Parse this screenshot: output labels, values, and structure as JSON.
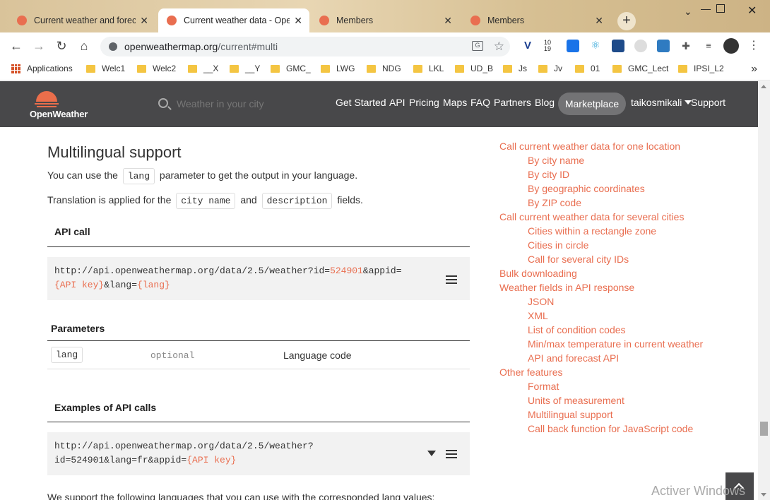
{
  "browser": {
    "tabs": [
      {
        "title": "Current weather and forecast",
        "active": false
      },
      {
        "title": "Current weather data - OpenWeatherMap",
        "active": true
      },
      {
        "title": "Members",
        "active": false
      },
      {
        "title": "Members",
        "active": false
      }
    ],
    "url_host": "openweathermap.org",
    "url_path": "/current#multi",
    "ext_date": "10",
    "ext_date2": "19",
    "bookmarks": [
      "Applications",
      "Welc1",
      "Welc2",
      "__X",
      "__Y",
      "GMC_",
      "LWG",
      "NDG",
      "LKL",
      "UD_B",
      "Js",
      "Jv",
      "01",
      "GMC_Lect",
      "IPSI_L2"
    ]
  },
  "site": {
    "logo_text": "OpenWeather",
    "search_placeholder": "Weather in your city",
    "nav": [
      "Get Started",
      "API",
      "Pricing",
      "Maps",
      "FAQ",
      "Partners",
      "Blog"
    ],
    "marketplace": "Marketplace",
    "user": "taikosmikali",
    "support": "Support"
  },
  "content": {
    "title": "Multilingual support",
    "p1_before": "You can use the",
    "p1_code": "lang",
    "p1_after": "parameter to get the output in your language.",
    "p2_before": "Translation is applied for the",
    "p2_code1": "city name",
    "p2_mid": "and",
    "p2_code2": "description",
    "p2_after": "fields.",
    "api_call_heading": "API call",
    "api_call_line1_a": "http://api.openweathermap.org/data/2.5/weather?id=",
    "api_call_line1_hl": "524901",
    "api_call_line1_b": "&appid=",
    "api_call_line2_hl1": "{API key}",
    "api_call_line2_b": "&lang=",
    "api_call_line2_hl2": "{lang}",
    "parameters_heading": "Parameters",
    "param_name": "lang",
    "param_required": "optional",
    "param_desc": "Language code",
    "examples_heading": "Examples of API calls",
    "example_line1": "http://api.openweathermap.org/data/2.5/weather?",
    "example_line2_a": "id=524901&lang=fr&appid=",
    "example_line2_hl": "{API key}",
    "cut_text": "We support the following languages that you can use with the corresponded lang values:"
  },
  "toc": [
    {
      "label": "Call current weather data for one location",
      "sub": false
    },
    {
      "label": "By city name",
      "sub": true
    },
    {
      "label": "By city ID",
      "sub": true
    },
    {
      "label": "By geographic coordinates",
      "sub": true
    },
    {
      "label": "By ZIP code",
      "sub": true
    },
    {
      "label": "Call current weather data for several cities",
      "sub": false
    },
    {
      "label": "Cities within a rectangle zone",
      "sub": true
    },
    {
      "label": "Cities in circle",
      "sub": true
    },
    {
      "label": "Call for several city IDs",
      "sub": true
    },
    {
      "label": "Bulk downloading",
      "sub": false
    },
    {
      "label": "Weather fields in API response",
      "sub": false
    },
    {
      "label": "JSON",
      "sub": true
    },
    {
      "label": "XML",
      "sub": true
    },
    {
      "label": "List of condition codes",
      "sub": true
    },
    {
      "label": "Min/max temperature in current weather",
      "sub": true
    },
    {
      "label": "API and forecast API",
      "sub": true
    },
    {
      "label": "Other features",
      "sub": false
    },
    {
      "label": "Format",
      "sub": true
    },
    {
      "label": "Units of measurement",
      "sub": true
    },
    {
      "label": "Multilingual support",
      "sub": true
    },
    {
      "label": "Call back function for JavaScript code",
      "sub": true
    }
  ],
  "watermark": "Activer Windows",
  "colors": {
    "accent": "#e96e50",
    "header_bg": "#48484a",
    "marketplace_bg": "#737375"
  }
}
